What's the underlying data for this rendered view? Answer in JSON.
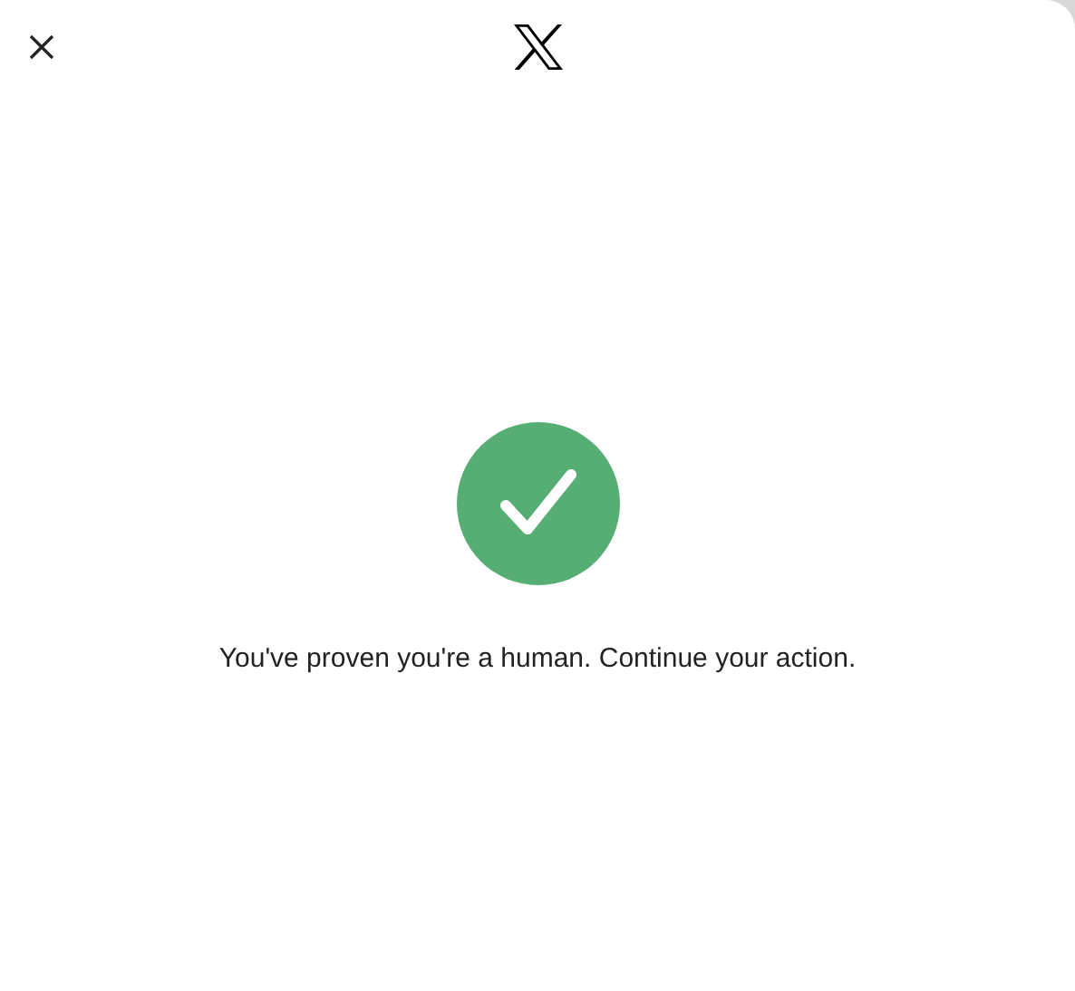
{
  "message": "You've proven you're a human. Continue your action."
}
